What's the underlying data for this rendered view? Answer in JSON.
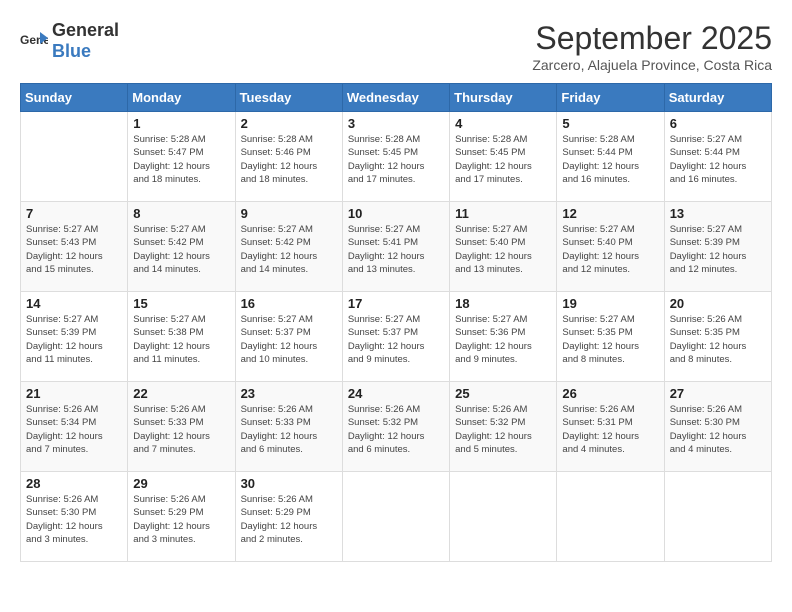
{
  "header": {
    "logo_general": "General",
    "logo_blue": "Blue",
    "month_title": "September 2025",
    "location": "Zarcero, Alajuela Province, Costa Rica"
  },
  "days_of_week": [
    "Sunday",
    "Monday",
    "Tuesday",
    "Wednesday",
    "Thursday",
    "Friday",
    "Saturday"
  ],
  "weeks": [
    [
      {
        "day": "",
        "info": ""
      },
      {
        "day": "1",
        "info": "Sunrise: 5:28 AM\nSunset: 5:47 PM\nDaylight: 12 hours\nand 18 minutes."
      },
      {
        "day": "2",
        "info": "Sunrise: 5:28 AM\nSunset: 5:46 PM\nDaylight: 12 hours\nand 18 minutes."
      },
      {
        "day": "3",
        "info": "Sunrise: 5:28 AM\nSunset: 5:45 PM\nDaylight: 12 hours\nand 17 minutes."
      },
      {
        "day": "4",
        "info": "Sunrise: 5:28 AM\nSunset: 5:45 PM\nDaylight: 12 hours\nand 17 minutes."
      },
      {
        "day": "5",
        "info": "Sunrise: 5:28 AM\nSunset: 5:44 PM\nDaylight: 12 hours\nand 16 minutes."
      },
      {
        "day": "6",
        "info": "Sunrise: 5:27 AM\nSunset: 5:44 PM\nDaylight: 12 hours\nand 16 minutes."
      }
    ],
    [
      {
        "day": "7",
        "info": "Sunrise: 5:27 AM\nSunset: 5:43 PM\nDaylight: 12 hours\nand 15 minutes."
      },
      {
        "day": "8",
        "info": "Sunrise: 5:27 AM\nSunset: 5:42 PM\nDaylight: 12 hours\nand 14 minutes."
      },
      {
        "day": "9",
        "info": "Sunrise: 5:27 AM\nSunset: 5:42 PM\nDaylight: 12 hours\nand 14 minutes."
      },
      {
        "day": "10",
        "info": "Sunrise: 5:27 AM\nSunset: 5:41 PM\nDaylight: 12 hours\nand 13 minutes."
      },
      {
        "day": "11",
        "info": "Sunrise: 5:27 AM\nSunset: 5:40 PM\nDaylight: 12 hours\nand 13 minutes."
      },
      {
        "day": "12",
        "info": "Sunrise: 5:27 AM\nSunset: 5:40 PM\nDaylight: 12 hours\nand 12 minutes."
      },
      {
        "day": "13",
        "info": "Sunrise: 5:27 AM\nSunset: 5:39 PM\nDaylight: 12 hours\nand 12 minutes."
      }
    ],
    [
      {
        "day": "14",
        "info": "Sunrise: 5:27 AM\nSunset: 5:39 PM\nDaylight: 12 hours\nand 11 minutes."
      },
      {
        "day": "15",
        "info": "Sunrise: 5:27 AM\nSunset: 5:38 PM\nDaylight: 12 hours\nand 11 minutes."
      },
      {
        "day": "16",
        "info": "Sunrise: 5:27 AM\nSunset: 5:37 PM\nDaylight: 12 hours\nand 10 minutes."
      },
      {
        "day": "17",
        "info": "Sunrise: 5:27 AM\nSunset: 5:37 PM\nDaylight: 12 hours\nand 9 minutes."
      },
      {
        "day": "18",
        "info": "Sunrise: 5:27 AM\nSunset: 5:36 PM\nDaylight: 12 hours\nand 9 minutes."
      },
      {
        "day": "19",
        "info": "Sunrise: 5:27 AM\nSunset: 5:35 PM\nDaylight: 12 hours\nand 8 minutes."
      },
      {
        "day": "20",
        "info": "Sunrise: 5:26 AM\nSunset: 5:35 PM\nDaylight: 12 hours\nand 8 minutes."
      }
    ],
    [
      {
        "day": "21",
        "info": "Sunrise: 5:26 AM\nSunset: 5:34 PM\nDaylight: 12 hours\nand 7 minutes."
      },
      {
        "day": "22",
        "info": "Sunrise: 5:26 AM\nSunset: 5:33 PM\nDaylight: 12 hours\nand 7 minutes."
      },
      {
        "day": "23",
        "info": "Sunrise: 5:26 AM\nSunset: 5:33 PM\nDaylight: 12 hours\nand 6 minutes."
      },
      {
        "day": "24",
        "info": "Sunrise: 5:26 AM\nSunset: 5:32 PM\nDaylight: 12 hours\nand 6 minutes."
      },
      {
        "day": "25",
        "info": "Sunrise: 5:26 AM\nSunset: 5:32 PM\nDaylight: 12 hours\nand 5 minutes."
      },
      {
        "day": "26",
        "info": "Sunrise: 5:26 AM\nSunset: 5:31 PM\nDaylight: 12 hours\nand 4 minutes."
      },
      {
        "day": "27",
        "info": "Sunrise: 5:26 AM\nSunset: 5:30 PM\nDaylight: 12 hours\nand 4 minutes."
      }
    ],
    [
      {
        "day": "28",
        "info": "Sunrise: 5:26 AM\nSunset: 5:30 PM\nDaylight: 12 hours\nand 3 minutes."
      },
      {
        "day": "29",
        "info": "Sunrise: 5:26 AM\nSunset: 5:29 PM\nDaylight: 12 hours\nand 3 minutes."
      },
      {
        "day": "30",
        "info": "Sunrise: 5:26 AM\nSunset: 5:29 PM\nDaylight: 12 hours\nand 2 minutes."
      },
      {
        "day": "",
        "info": ""
      },
      {
        "day": "",
        "info": ""
      },
      {
        "day": "",
        "info": ""
      },
      {
        "day": "",
        "info": ""
      }
    ]
  ]
}
